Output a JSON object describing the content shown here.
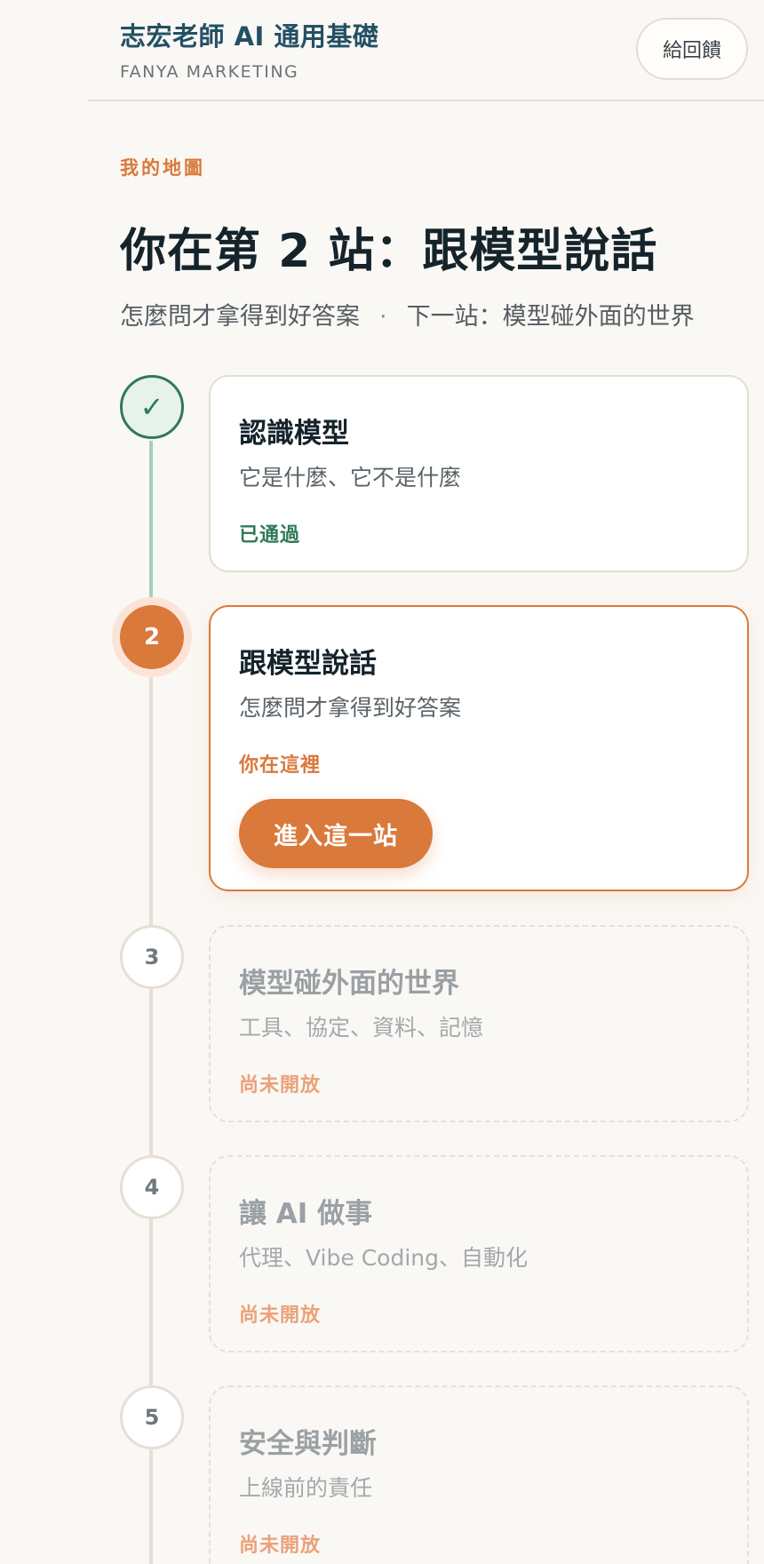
{
  "header": {
    "title": "志宏老師 AI 通用基礎",
    "subtitle": "FANYA MARKETING",
    "feedback_label": "給回饋"
  },
  "intro": {
    "eyebrow": "我的地圖",
    "title": "你在第 2 站：跟模型說話",
    "subtitle_current": "怎麼問才拿得到好答案",
    "subtitle_separator": "·",
    "subtitle_next": "下一站：模型碰外面的世界"
  },
  "stations": [
    {
      "node": "✓",
      "title": "認識模型",
      "description": "它是什麼、它不是什麼",
      "status": "已通過",
      "state": "done"
    },
    {
      "node": "2",
      "title": "跟模型說話",
      "description": "怎麼問才拿得到好答案",
      "status": "你在這裡",
      "state": "current",
      "action_label": "進入這一站"
    },
    {
      "node": "3",
      "title": "模型碰外面的世界",
      "description": "工具、協定、資料、記憶",
      "status": "尚未開放",
      "state": "locked"
    },
    {
      "node": "4",
      "title": "讓 AI 做事",
      "description": "代理、Vibe Coding、自動化",
      "status": "尚未開放",
      "state": "locked"
    },
    {
      "node": "5",
      "title": "安全與判斷",
      "description": "上線前的責任",
      "status": "尚未開放",
      "state": "locked"
    }
  ],
  "colors": {
    "accent": "#d9793b",
    "done": "#2f7a58",
    "brand": "#245064",
    "background": "#faf8f5"
  }
}
